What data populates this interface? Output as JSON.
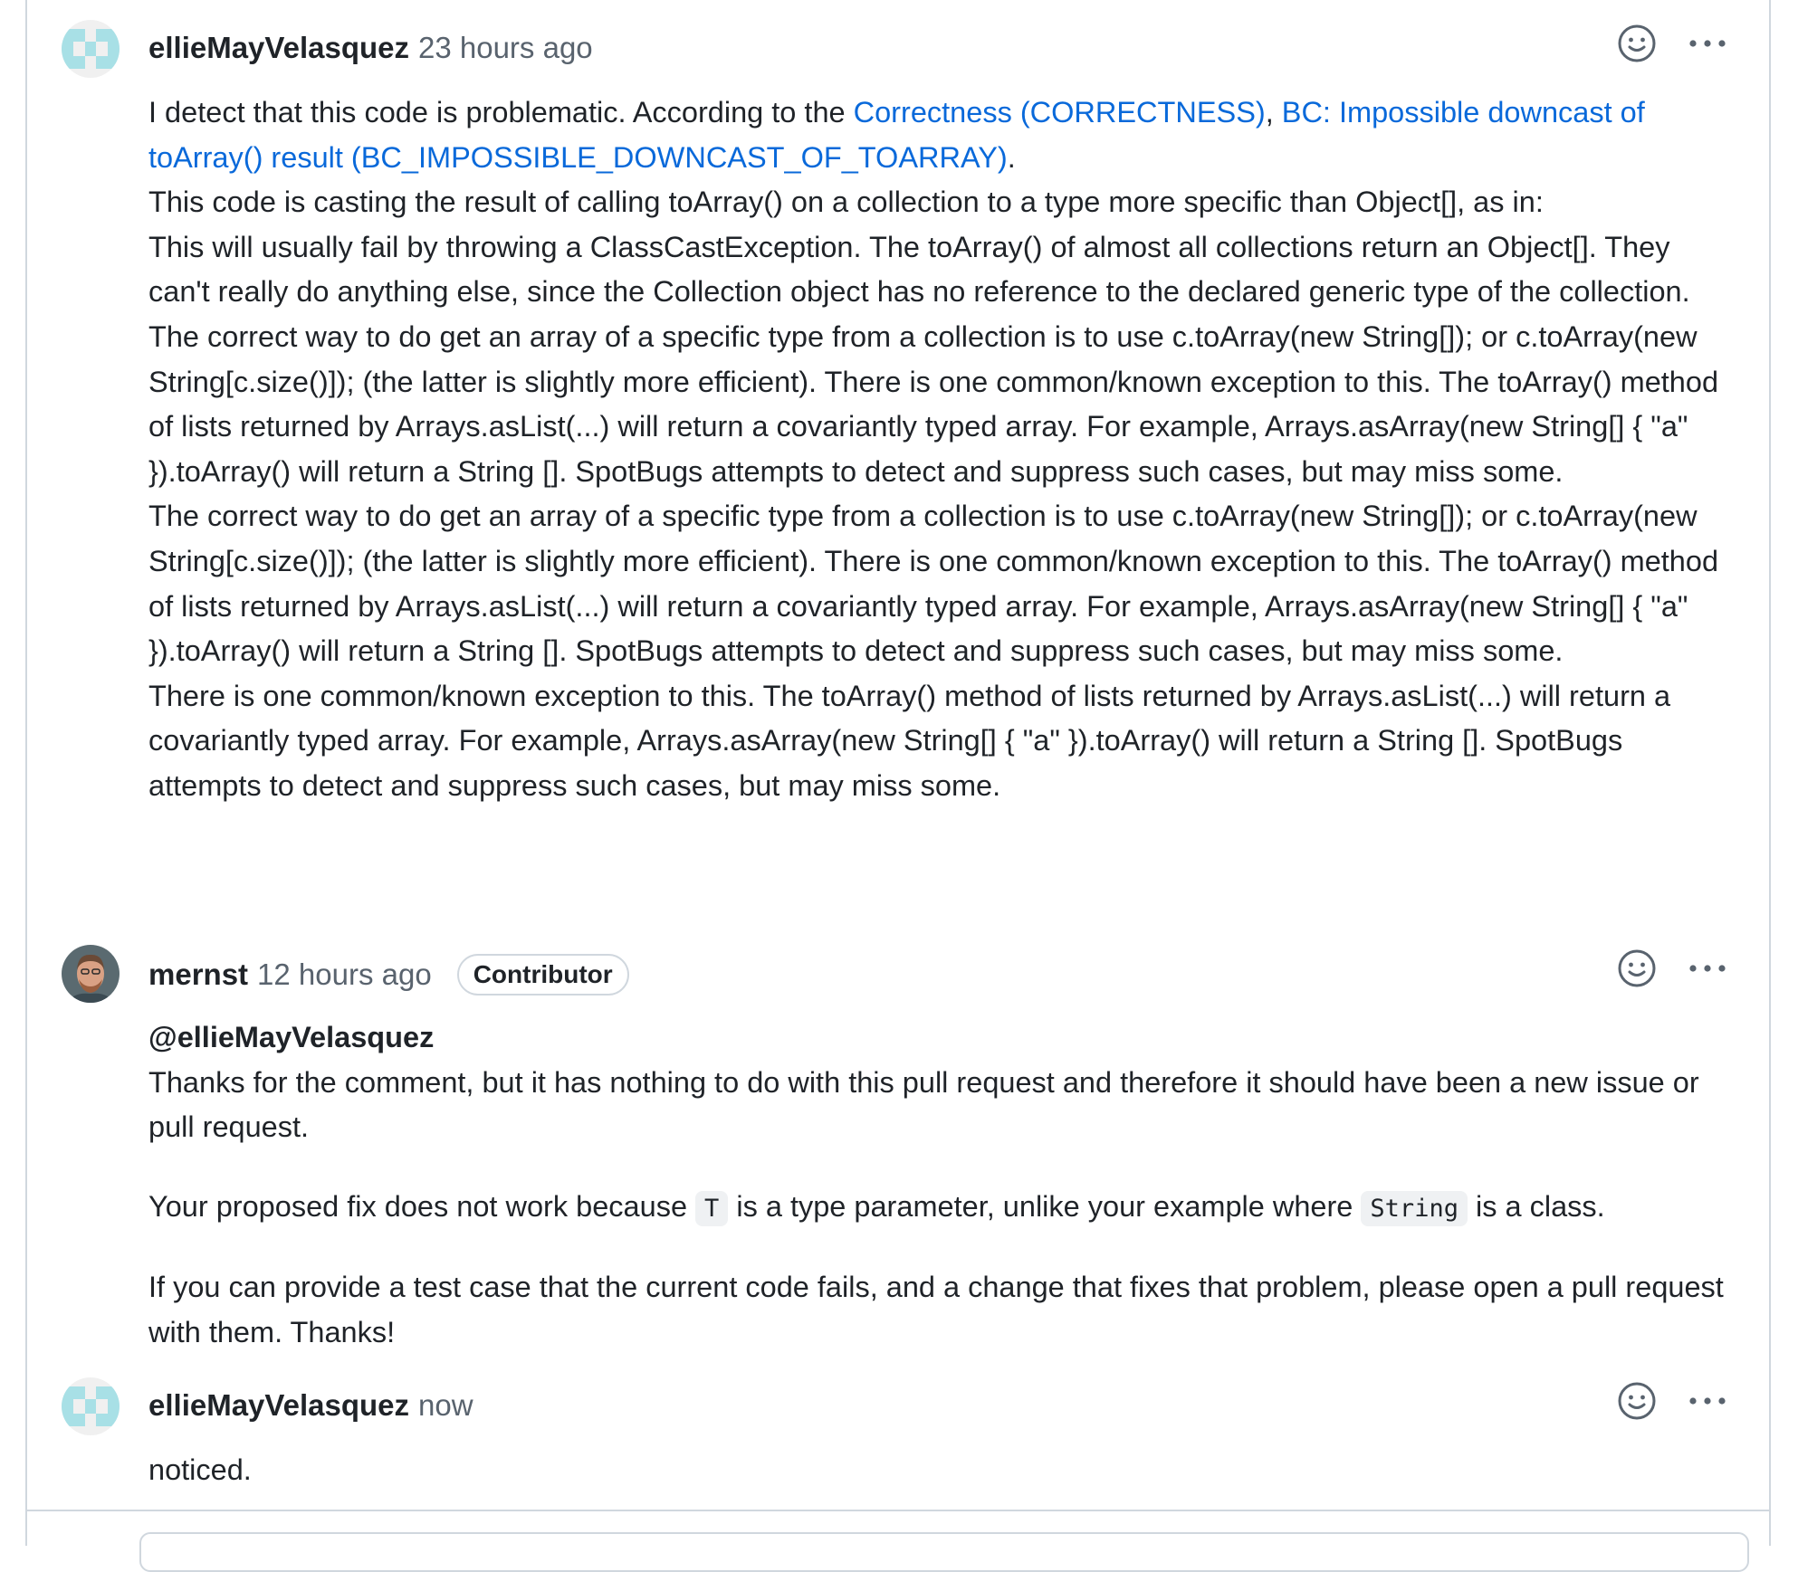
{
  "comments": [
    {
      "author": "ellieMayVelasquez",
      "time": "23 hours ago",
      "intro_text": "I detect that this code is problematic. According to the ",
      "link1": "Correctness (CORRECTNESS)",
      "comma": ", ",
      "link2": "BC: Impossible downcast of toArray() result (BC_IMPOSSIBLE_DOWNCAST_OF_TOARRAY)",
      "period": ".",
      "paragraphs": [
        "This code is casting the result of calling toArray() on a collection to a type more specific than Object[], as in:",
        "This will usually fail by throwing a ClassCastException. The toArray() of almost all collections return an Object[]. They can't really do anything else, since the Collection object has no reference to the declared generic type of the collection. The correct way to do get an array of a specific type from a collection is to use c.toArray(new String[]); or c.toArray(new String[c.size()]); (the latter is slightly more efficient). There is one common/known exception to this. The toArray() method of lists returned by Arrays.asList(...) will return a covariantly typed array. For example, Arrays.asArray(new String[] { \"a\" }).toArray() will return a String []. SpotBugs attempts to detect and suppress such cases, but may miss some.",
        "The correct way to do get an array of a specific type from a collection is to use c.toArray(new String[]); or c.toArray(new String[c.size()]); (the latter is slightly more efficient). There is one common/known exception to this. The toArray() method of lists returned by Arrays.asList(...) will return a covariantly typed array. For example, Arrays.asArray(new String[] { \"a\" }).toArray() will return a String []. SpotBugs attempts to detect and suppress such cases, but may miss some.",
        "There is one common/known exception to this. The toArray() method of lists returned by Arrays.asList(...) will return a covariantly typed array. For example, Arrays.asArray(new String[] { \"a\" }).toArray() will return a String []. SpotBugs attempts to detect and suppress such cases, but may miss some."
      ]
    },
    {
      "author": "mernst",
      "time": "12 hours ago",
      "badge": "Contributor",
      "mention": "@ellieMayVelasquez",
      "line1": "Thanks for the comment, but it has nothing to do with this pull request and therefore it should have been a new issue or pull request.",
      "line2_a": "Your proposed fix does not work because ",
      "code1": "T",
      "line2_b": " is a type parameter, unlike your example where ",
      "code2": "String",
      "line2_c": " is a class.",
      "line3": "If you can provide a test case that the current code fails, and a change that fixes that problem, please open a pull request with them. Thanks!"
    },
    {
      "author": "ellieMayVelasquez",
      "time": "now",
      "text": "noticed."
    }
  ],
  "icons": {
    "reaction": "smiley-icon",
    "menu": "kebab-horizontal-icon"
  },
  "colors": {
    "link": "#0969da",
    "muted": "#59636e",
    "border": "#d0d7de",
    "identicon": "#a8e0e6"
  }
}
